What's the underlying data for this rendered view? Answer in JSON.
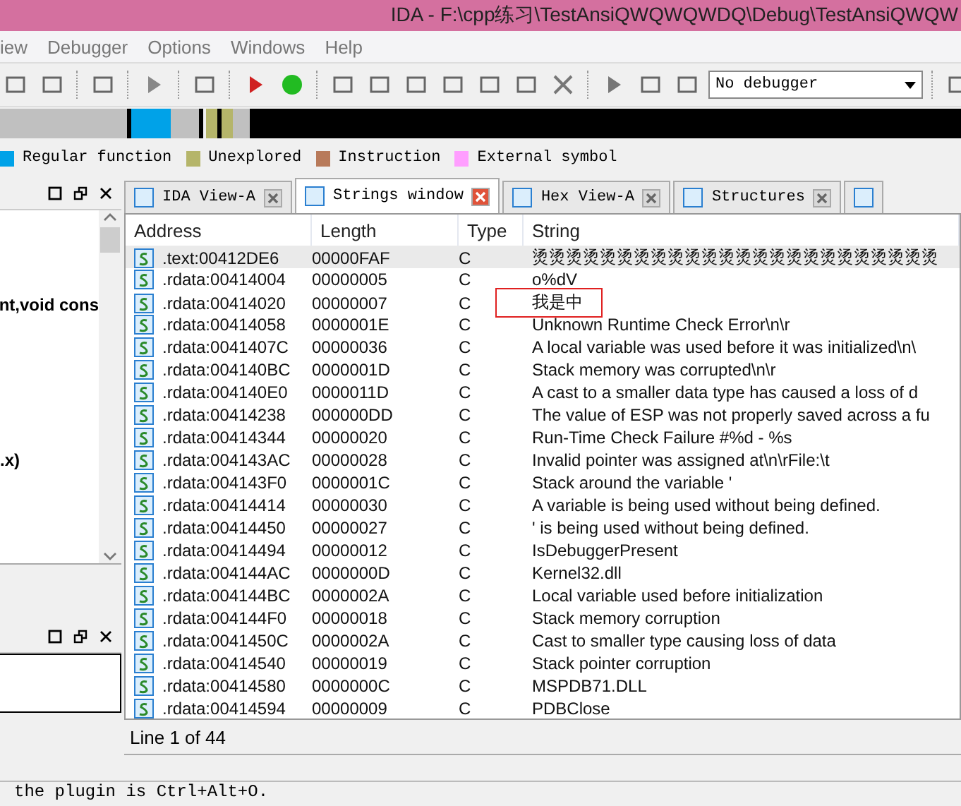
{
  "window": {
    "title": "IDA - F:\\cpp练习\\TestAnsiQWQWQWDQ\\Debug\\TestAnsiQWQW"
  },
  "menu": [
    {
      "label": "iew"
    },
    {
      "label": "Debugger"
    },
    {
      "label": "Options"
    },
    {
      "label": "Windows"
    },
    {
      "label": "Help"
    }
  ],
  "toolbar": {
    "debugger_select": {
      "value": "No debugger"
    }
  },
  "legend": [
    {
      "label": "Regular function",
      "color": "#00a2e8"
    },
    {
      "label": "Unexplored",
      "color": "#b5b56a"
    },
    {
      "label": "Instruction",
      "color": "#b87a5a"
    },
    {
      "label": "External symbol",
      "color": "#ff9eff"
    }
  ],
  "functions_panel": {
    "lines": [
      {
        "text": "nt,void cons"
      },
      {
        "text": ".x)"
      }
    ]
  },
  "tabs": [
    {
      "label": "IDA View-A",
      "selected": false
    },
    {
      "label": "Strings window",
      "selected": true
    },
    {
      "label": "Hex View-A",
      "selected": false
    },
    {
      "label": "Structures",
      "selected": false
    }
  ],
  "table": {
    "columns": [
      "Address",
      "Length",
      "Type",
      "String"
    ],
    "rows": [
      {
        "address": ".text:00412DE6",
        "length": "00000FAF",
        "type": "C",
        "string": "烫烫烫烫烫烫烫烫烫烫烫烫烫烫烫烫烫烫烫烫烫烫烫烫",
        "selected": true
      },
      {
        "address": ".rdata:00414004",
        "length": "00000005",
        "type": "C",
        "string": "o%dV",
        "selected": false
      },
      {
        "address": ".rdata:00414020",
        "length": "00000007",
        "type": "C",
        "string": "我是中",
        "selected": false,
        "highlighted": true
      },
      {
        "address": ".rdata:00414058",
        "length": "0000001E",
        "type": "C",
        "string": "Unknown Runtime Check Error\\n\\r",
        "selected": false
      },
      {
        "address": ".rdata:0041407C",
        "length": "00000036",
        "type": "C",
        "string": "A local variable was used before it was initialized\\n\\",
        "selected": false
      },
      {
        "address": ".rdata:004140BC",
        "length": "0000001D",
        "type": "C",
        "string": "Stack memory was corrupted\\n\\r",
        "selected": false
      },
      {
        "address": ".rdata:004140E0",
        "length": "0000011D",
        "type": "C",
        "string": "A cast to a smaller data type has caused a loss of d",
        "selected": false
      },
      {
        "address": ".rdata:00414238",
        "length": "000000DD",
        "type": "C",
        "string": "The value of ESP was not properly saved across a fu",
        "selected": false
      },
      {
        "address": ".rdata:00414344",
        "length": "00000020",
        "type": "C",
        "string": "Run-Time Check Failure #%d - %s",
        "selected": false
      },
      {
        "address": ".rdata:004143AC",
        "length": "00000028",
        "type": "C",
        "string": "Invalid pointer was assigned at\\n\\rFile:\\t",
        "selected": false
      },
      {
        "address": ".rdata:004143F0",
        "length": "0000001C",
        "type": "C",
        "string": "Stack around the variable '",
        "selected": false
      },
      {
        "address": ".rdata:00414414",
        "length": "00000030",
        "type": "C",
        "string": "A variable is being used without being defined.",
        "selected": false
      },
      {
        "address": ".rdata:00414450",
        "length": "00000027",
        "type": "C",
        "string": "' is being used without being defined.",
        "selected": false
      },
      {
        "address": ".rdata:00414494",
        "length": "00000012",
        "type": "C",
        "string": "IsDebuggerPresent",
        "selected": false
      },
      {
        "address": ".rdata:004144AC",
        "length": "0000000D",
        "type": "C",
        "string": "Kernel32.dll",
        "selected": false
      },
      {
        "address": ".rdata:004144BC",
        "length": "0000002A",
        "type": "C",
        "string": "Local variable used before initialization",
        "selected": false
      },
      {
        "address": ".rdata:004144F0",
        "length": "00000018",
        "type": "C",
        "string": "Stack memory corruption",
        "selected": false
      },
      {
        "address": ".rdata:0041450C",
        "length": "0000002A",
        "type": "C",
        "string": "Cast to smaller type causing loss of data",
        "selected": false
      },
      {
        "address": ".rdata:00414540",
        "length": "00000019",
        "type": "C",
        "string": "Stack pointer corruption",
        "selected": false
      },
      {
        "address": ".rdata:00414580",
        "length": "0000000C",
        "type": "C",
        "string": "MSPDB71.DLL",
        "selected": false
      },
      {
        "address": ".rdata:00414594",
        "length": "00000009",
        "type": "C",
        "string": "PDBClose",
        "selected": false
      }
    ]
  },
  "status": "Line 1 of 44",
  "output": {
    "text": "the plugin is Ctrl+Alt+O."
  }
}
